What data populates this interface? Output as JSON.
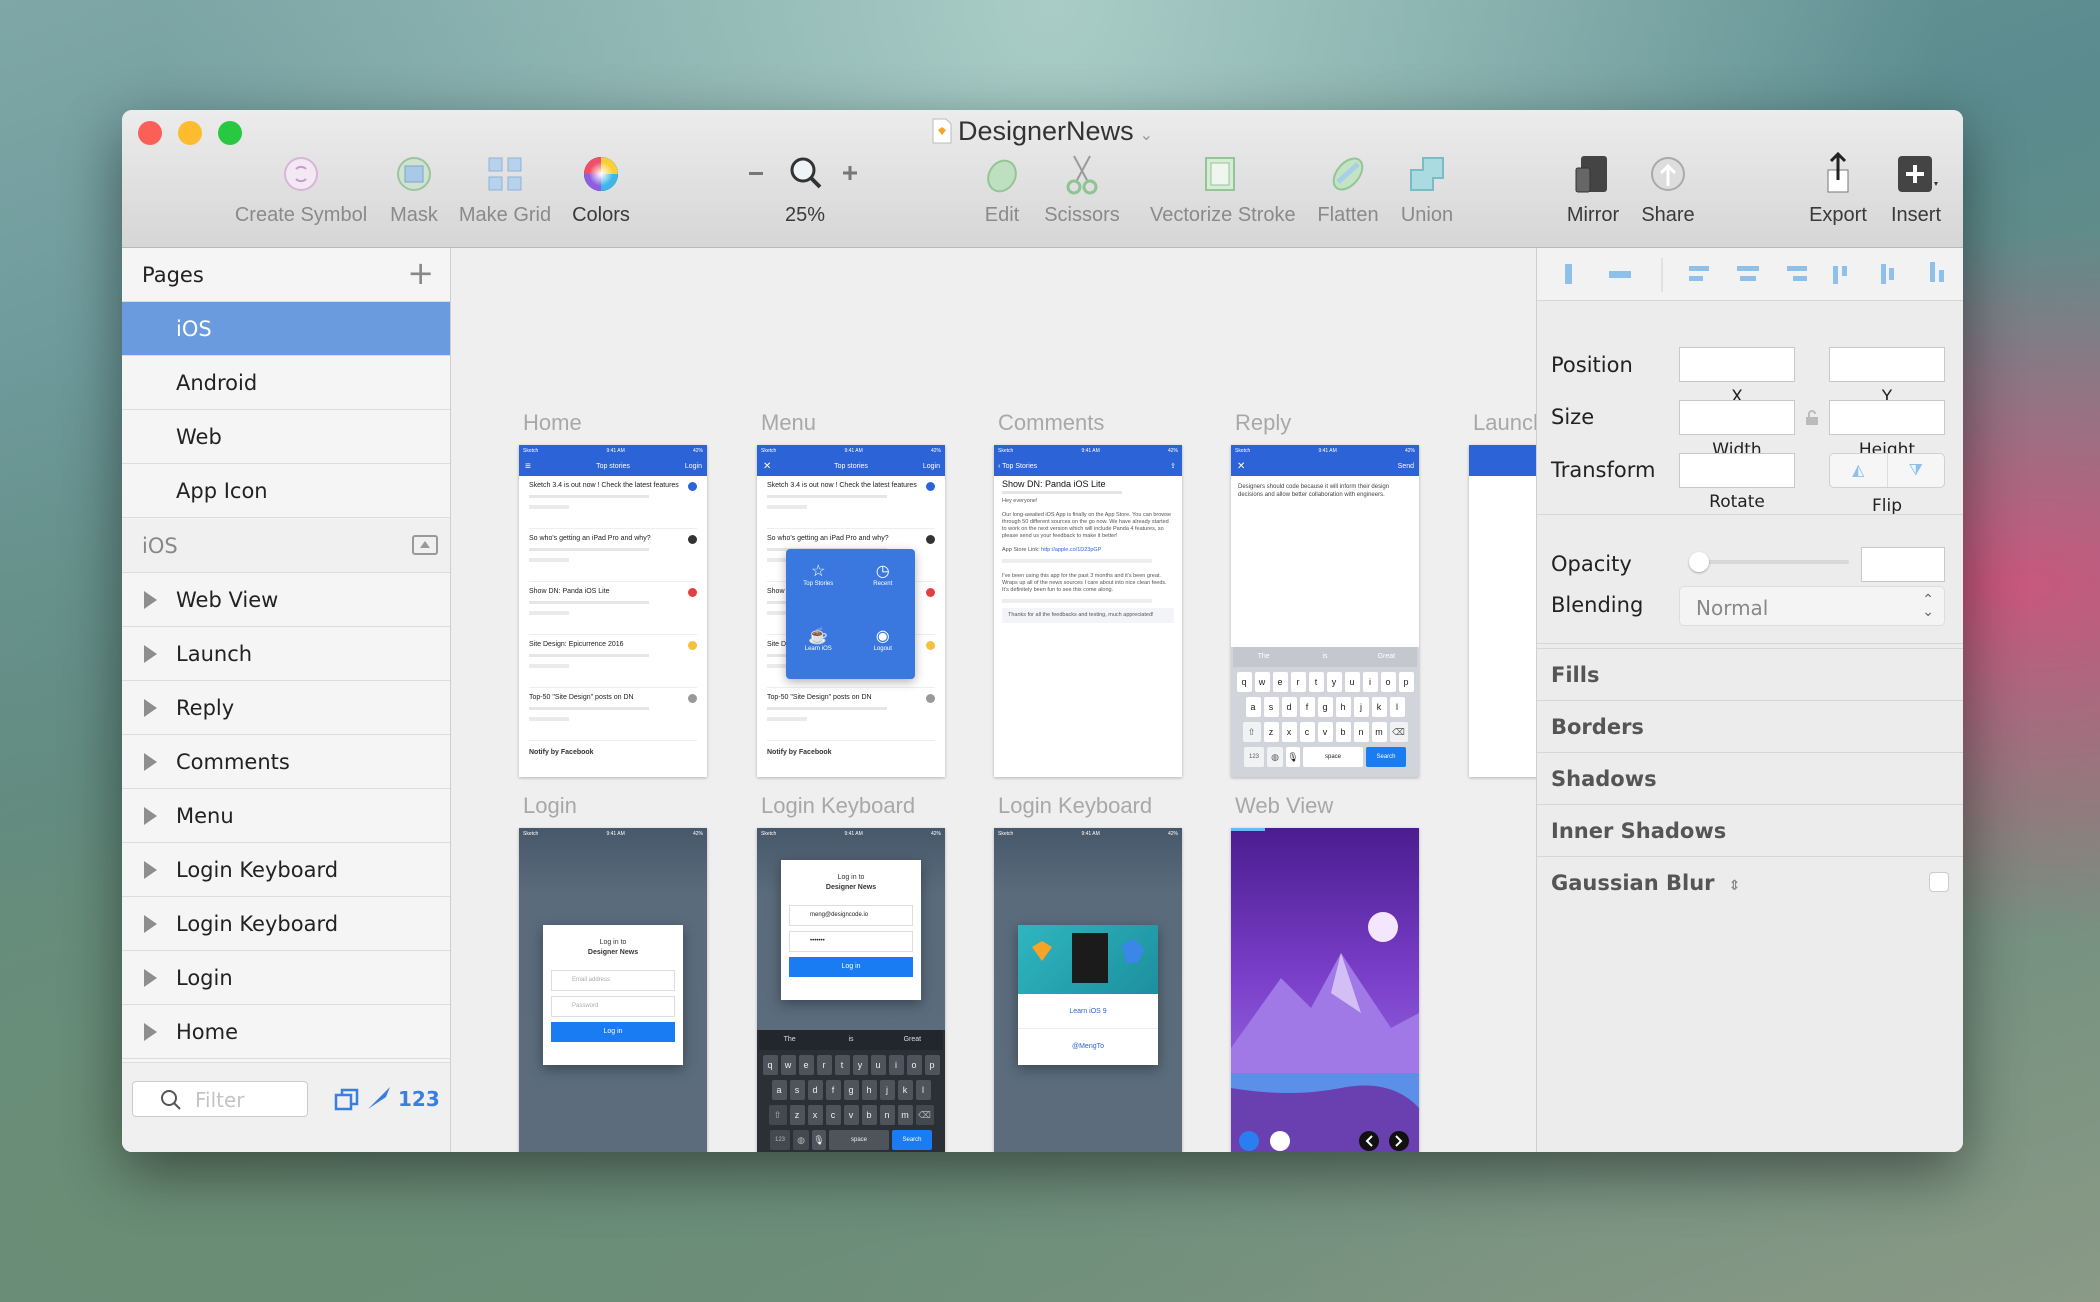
{
  "window": {
    "title": "DesignerNews",
    "traffic_lights": {
      "close": "#fc5f57",
      "minimize": "#fdbc2e",
      "zoom": "#28c840"
    }
  },
  "toolbar": {
    "create_symbol": "Create Symbol",
    "mask": "Mask",
    "make_grid": "Make Grid",
    "colors": "Colors",
    "zoom_level": "25%",
    "edit": "Edit",
    "scissors": "Scissors",
    "vectorize_stroke": "Vectorize Stroke",
    "flatten": "Flatten",
    "union": "Union",
    "mirror": "Mirror",
    "share": "Share",
    "export": "Export",
    "insert": "Insert"
  },
  "sidebar": {
    "pages_title": "Pages",
    "pages": [
      {
        "label": "iOS",
        "selected": true
      },
      {
        "label": "Android"
      },
      {
        "label": "Web"
      },
      {
        "label": "App Icon"
      }
    ],
    "layers_title": "iOS",
    "layers": [
      "Web View",
      "Launch",
      "Reply",
      "Comments",
      "Menu",
      "Login Keyboard",
      "Login Keyboard",
      "Login",
      "Home"
    ],
    "filter_placeholder": "Filter",
    "footer_count": "123",
    "selected_color": "#6b9bdf"
  },
  "artboards": {
    "labels": [
      "Home",
      "Menu",
      "Comments",
      "Reply",
      "Launch",
      "Login",
      "Login Keyboard",
      "Login Keyboard",
      "Web View"
    ],
    "status": {
      "carrier": "Sketch",
      "time": "9:41 AM",
      "battery": "42%"
    },
    "home": {
      "nav_title": "Top stories",
      "nav_action": "Login",
      "footer": "Notify by Facebook",
      "items": [
        {
          "title": "Sketch 3.4 is out now ! Check the latest features",
          "color": "#2c63d6"
        },
        {
          "title": "So who's getting an iPad Pro and why?",
          "color": "#333333"
        },
        {
          "title": "Show DN: Panda iOS Lite",
          "color": "#e04040"
        },
        {
          "title": "Site Design: Epicurrence 2016",
          "color": "#f3c23a"
        },
        {
          "title": "Top-50 \"Site Design\" posts on DN",
          "color": "#999999"
        }
      ]
    },
    "menu": {
      "items": [
        "Top Stories",
        "Recent",
        "Learn iOS",
        "Logout"
      ]
    },
    "comments": {
      "back": "Top Stories",
      "title": "Show DN: Panda iOS Lite",
      "greeting": "Hey everyone!",
      "body": "Our long-awaited iOS App is finally on the App Store. You can browse through 50 different sources on the go now. We have already started to work on the next version which will include Panda 4 features, so please send us your feedback to make it better!",
      "link_label": "App Store Link:",
      "link": "http://apple.co/1D23pGP",
      "comment": "I've been using this app for the past 3 months and it's been great. Wraps up all of the news sources I care about into nice clean feeds. It's definitely been fun to see this come along.",
      "reply": "Thanks for all the feedbacks and testing, much appreciated!"
    },
    "reply": {
      "send": "Send",
      "text": "Designers should code because it will inform their design decisions and allow better collaboration with engineers."
    },
    "keyboard": {
      "suggestions": [
        "The",
        "is",
        "Great"
      ],
      "rows": [
        "qwertyuiop",
        "asdfghjkl",
        "zxcvbnm"
      ],
      "num": "123",
      "space": "space",
      "search": "Search"
    },
    "login": {
      "heading1": "Log in to",
      "heading2": "Designer News",
      "email_placeholder": "Email address",
      "password_placeholder": "Password",
      "button": "Log in",
      "email_value": "meng@designcode.io",
      "password_value": "•••••••"
    },
    "promo": {
      "learn": "Learn iOS 9",
      "twitter": "@MengTo"
    }
  },
  "inspector": {
    "position": "Position",
    "x": "X",
    "y": "Y",
    "size": "Size",
    "width": "Width",
    "height": "Height",
    "transform": "Transform",
    "rotate": "Rotate",
    "flip": "Flip",
    "opacity": "Opacity",
    "opacity_value": 0,
    "blending": "Blending",
    "blending_value": "Normal",
    "sections": [
      "Fills",
      "Borders",
      "Shadows",
      "Inner Shadows",
      "Gaussian Blur"
    ]
  }
}
